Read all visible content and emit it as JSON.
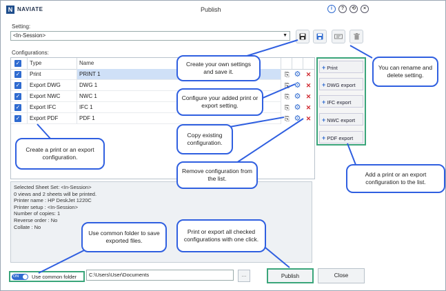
{
  "titlebar": {
    "brand": "NAVIATE",
    "logo_letter": "N",
    "title": "Publish",
    "info_symbol": "i",
    "help_symbol": "?"
  },
  "setting": {
    "label": "Setting:",
    "value": "<In-Session>"
  },
  "configurations": {
    "label": "Configurations:",
    "headers": [
      "Type",
      "Name"
    ],
    "rows": [
      {
        "type": "Print",
        "name": "PRINT 1"
      },
      {
        "type": "Export DWG",
        "name": "DWG 1"
      },
      {
        "type": "Export NWC",
        "name": "NWC 1"
      },
      {
        "type": "Export IFC",
        "name": "IFC 1"
      },
      {
        "type": "Export PDF",
        "name": "PDF 1"
      }
    ]
  },
  "add_buttons": [
    "Print",
    "DWG export",
    "IFC export",
    "NWC export",
    "PDF export"
  ],
  "log": [
    "Selected Sheet Set: <In-Session>",
    "0 views and 2 sheets will be printed.",
    "Printer name : HP DeskJet 1220C",
    "Printer setup : <In-Session>",
    "Number of copies: 1",
    "Reverse order : No",
    "Collate : No"
  ],
  "footer": {
    "toggle_state": "ON",
    "toggle_label": "Use common folder",
    "path": "C:\\Users\\User\\Documents",
    "browse": "...",
    "publish": "Publish",
    "close": "Close"
  },
  "callouts": {
    "create_own": "Create your own settings and save it.",
    "rename": "You can rename and delete setting.",
    "configure": "Configure your added print or export setting.",
    "create_config": "Create a print or an export configuration.",
    "copy": "Copy existing configuration.",
    "remove": "Remove configuration from the list.",
    "add": "Add a print or an export configuration to the list.",
    "common_folder": "Use common folder to save exported files.",
    "publish_all": "Print or export all checked configurations with one click."
  },
  "icons": {
    "save": "save-icon",
    "save_as": "save-as-icon",
    "rename": "rename-icon",
    "delete": "trash-icon",
    "copy": "copy-icon",
    "configure": "gear-icon",
    "remove": "close-icon"
  },
  "colors": {
    "accent": "#2f6bd0",
    "callout_border": "#2f5fe0",
    "highlight_green": "#3aa57a",
    "selected_row": "#cfe0f7",
    "remove_red": "#d0282e"
  }
}
